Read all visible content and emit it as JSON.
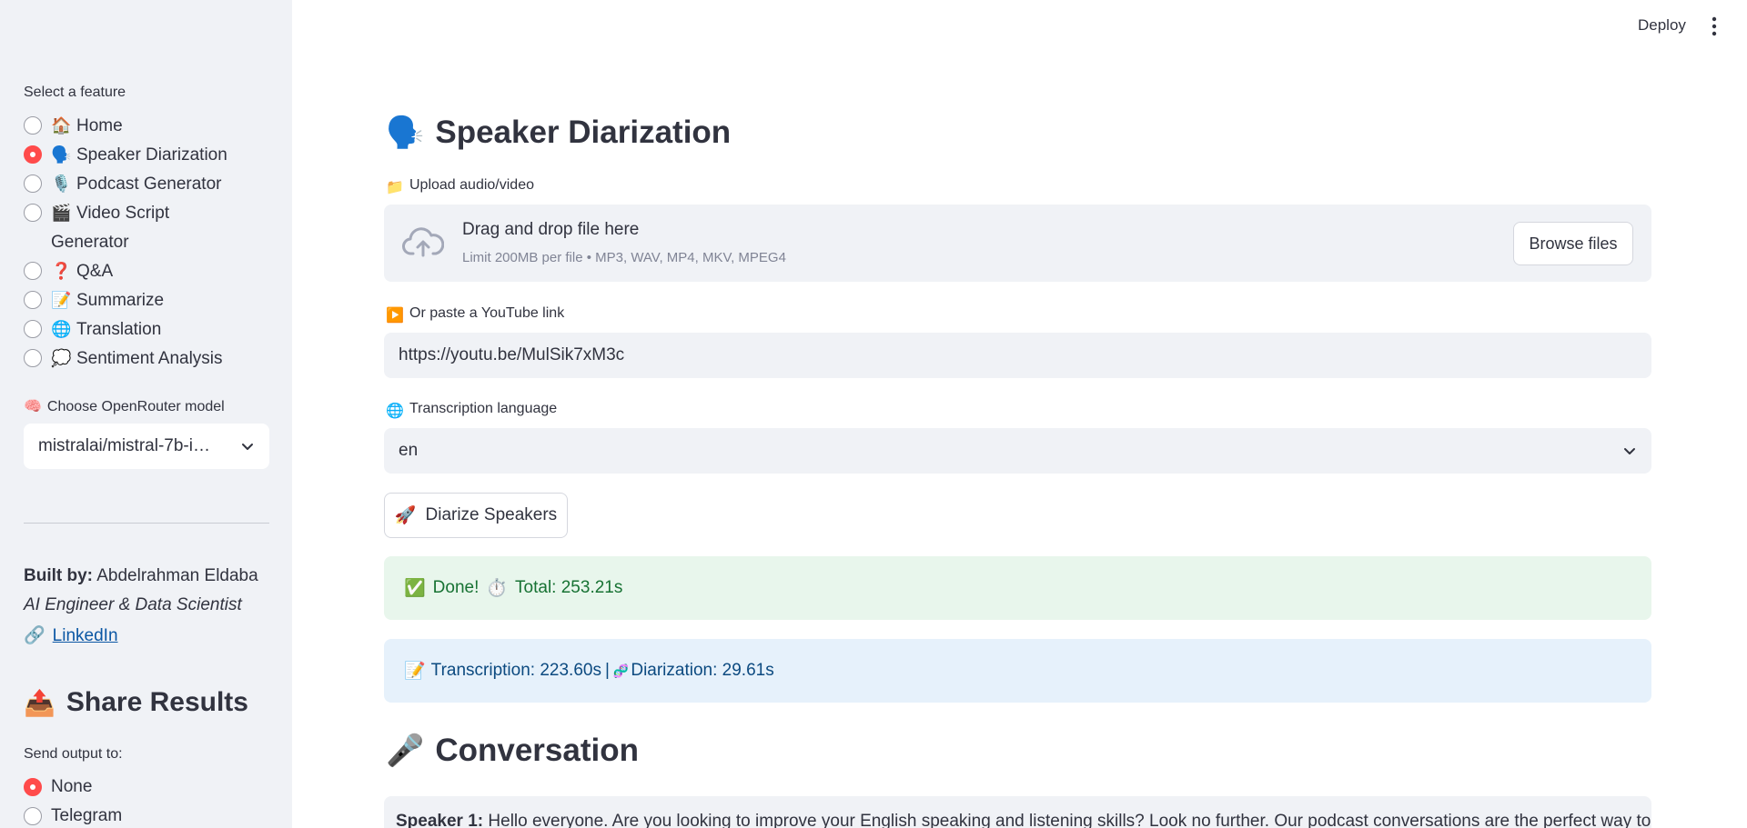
{
  "topbar": {
    "deploy_label": "Deploy",
    "menu_icon": "kebab-menu-icon"
  },
  "sidebar": {
    "feature_label": "Select a feature",
    "features": [
      {
        "emoji": "🏠",
        "label": "Home",
        "checked": false
      },
      {
        "emoji": "🗣️",
        "label": "Speaker Diarization",
        "checked": true
      },
      {
        "emoji": "🎙️",
        "label": "Podcast Generator",
        "checked": false
      },
      {
        "emoji": "🎬",
        "label": "Video Script",
        "label2": "Generator",
        "checked": false
      },
      {
        "emoji": "❓",
        "label": "Q&A",
        "checked": false
      },
      {
        "emoji": "📝",
        "label": "Summarize",
        "checked": false
      },
      {
        "emoji": "🌐",
        "label": "Translation",
        "checked": false
      },
      {
        "emoji": "💭",
        "label": "Sentiment Analysis",
        "checked": false
      }
    ],
    "model_label": "Choose OpenRouter model",
    "model_emoji": "🧠",
    "model_value": "mistralai/mistral-7b-i…",
    "built_by_label": "Built by:",
    "built_by_name": "Abdelrahman Eldaba",
    "built_by_role": "AI Engineer & Data Scientist",
    "link_emoji": "🔗",
    "link_text": "LinkedIn",
    "share_emoji": "📤",
    "share_title": "Share Results",
    "send_label": "Send output to:",
    "send_options": [
      {
        "label": "None",
        "checked": true
      },
      {
        "label": "Telegram",
        "checked": false
      }
    ]
  },
  "main": {
    "title_emoji": "🗣️",
    "title": "Speaker Diarization",
    "upload_emoji": "📁",
    "upload_label": "Upload audio/video",
    "drop_text": "Drag and drop file here",
    "limit_text": "Limit 200MB per file • MP3, WAV, MP4, MKV, MPEG4",
    "browse_label": "Browse files",
    "youtube_emoji": "▶️",
    "youtube_label": "Or paste a YouTube link",
    "youtube_value": "https://youtu.be/MulSik7xM3c",
    "lang_emoji": "🌐",
    "lang_label": "Transcription language",
    "lang_value": "en",
    "diarize_emoji": "🚀",
    "diarize_label": "Diarize Speakers",
    "success_check": "✅",
    "success_done": "Done!",
    "success_timer": "⏱️",
    "success_total": "Total: 253.21s",
    "info_emoji": "📝",
    "info_transcription": "Transcription: 223.60s",
    "info_sep": "|",
    "info_emoji2": "🧬",
    "info_diarization": "Diarization: 29.61s",
    "conv_emoji": "🎤",
    "conv_title": "Conversation",
    "speaker_label": "Speaker 1:",
    "speaker_text": "Hello everyone. Are you looking to improve your English speaking and listening skills? Look no further. Our podcast conversations are the perfect way to"
  }
}
